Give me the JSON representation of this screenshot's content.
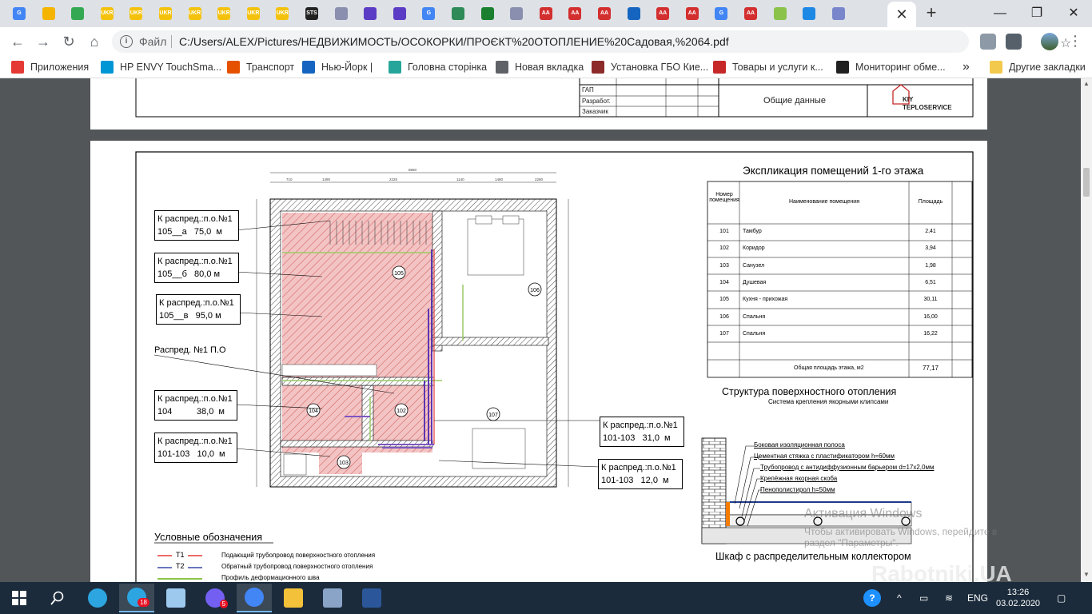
{
  "browser": {
    "tabs": [
      {
        "icon": "google-icon",
        "color": "#4285f4",
        "text": "G"
      },
      {
        "icon": "bookmark-tab-icon",
        "color": "#f4b400",
        "text": ""
      },
      {
        "icon": "mail-icon",
        "color": "#34a853",
        "text": ""
      },
      {
        "icon": "uka-go-icon",
        "color": "#f4c20d",
        "text": "UKR GO"
      },
      {
        "icon": "uka-go-icon",
        "color": "#f4c20d",
        "text": "UKR GO"
      },
      {
        "icon": "uka-go-icon",
        "color": "#f4c20d",
        "text": "UKR GO"
      },
      {
        "icon": "uka-go-icon",
        "color": "#f4c20d",
        "text": "UKR GO"
      },
      {
        "icon": "uka-go-icon",
        "color": "#f4c20d",
        "text": "UKR GO"
      },
      {
        "icon": "uka-go-icon",
        "color": "#f4c20d",
        "text": "UKR GO"
      },
      {
        "icon": "uka-go-icon",
        "color": "#f4c20d",
        "text": "UKR GO"
      },
      {
        "icon": "sts-icon",
        "color": "#222222",
        "text": "STS"
      },
      {
        "icon": "settings-tab-icon",
        "color": "#8a8fb0",
        "text": ""
      },
      {
        "icon": "purple-square-icon",
        "color": "#5b3cc4",
        "text": ""
      },
      {
        "icon": "purple-square-icon",
        "color": "#5b3cc4",
        "text": ""
      },
      {
        "icon": "google-icon",
        "color": "#4285f4",
        "text": "G"
      },
      {
        "icon": "lightning-icon",
        "color": "#2e8b57",
        "text": ""
      },
      {
        "icon": "green-circle-icon",
        "color": "#1a7f2e",
        "text": ""
      },
      {
        "icon": "settings-tab-icon",
        "color": "#8a8fb0",
        "text": ""
      },
      {
        "icon": "aa-icon",
        "color": "#d32f2f",
        "text": "AA"
      },
      {
        "icon": "aa-icon",
        "color": "#d32f2f",
        "text": "AA"
      },
      {
        "icon": "aa-icon",
        "color": "#d32f2f",
        "text": "AA"
      },
      {
        "icon": "chat-icon",
        "color": "#1565c0",
        "text": ""
      },
      {
        "icon": "aa-icon",
        "color": "#d32f2f",
        "text": "AA"
      },
      {
        "icon": "aa-icon",
        "color": "#d32f2f",
        "text": "AA"
      },
      {
        "icon": "google-icon",
        "color": "#4285f4",
        "text": "G"
      },
      {
        "icon": "aa-icon",
        "color": "#d32f2f",
        "text": "AA"
      },
      {
        "icon": "search-tab-icon",
        "color": "#8bc34a",
        "text": ""
      },
      {
        "icon": "house-icon",
        "color": "#1e88e5",
        "text": ""
      },
      {
        "icon": "snowflake-icon",
        "color": "#7986cb",
        "text": ""
      }
    ],
    "active_tab_close": "✕",
    "new_tab": "+",
    "window": {
      "minimize": "—",
      "restore": "❐",
      "close": "✕"
    },
    "omnibox": {
      "label": "Файл",
      "url": "C:/Users/ALEX/Pictures/НЕДВИЖИМОСТЬ/ОСОКОРКИ/ПРОЄКТ%20ОТОПЛЕНИЕ%20Садовая,%2064.pdf"
    },
    "bookmarks": [
      {
        "label": "Приложения",
        "icon": "apps-grid-icon",
        "color": "#e53935"
      },
      {
        "label": "HP ENVY TouchSma...",
        "icon": "hp-icon",
        "color": "#0096d6"
      },
      {
        "label": "Транспорт",
        "icon": "bars-icon",
        "color": "#e65100"
      },
      {
        "label": "Нью-Йорк |",
        "icon": "rusrek-icon",
        "color": "#1565c0"
      },
      {
        "label": "Головна сторінка",
        "icon": "tree-icon",
        "color": "#26a69a"
      },
      {
        "label": "Новая вкладка",
        "icon": "globe-icon",
        "color": "#5f6368"
      },
      {
        "label": "Установка ГБО Кие...",
        "icon": "gear-bookmark-icon",
        "color": "#8d2b2b"
      },
      {
        "label": "Товары и услуги к...",
        "icon": "bars-icon",
        "color": "#c62828"
      },
      {
        "label": "Мониторинг обме...",
        "icon": "bc-icon",
        "color": "#212121"
      }
    ],
    "bookmarks_more": "»",
    "other_bookmarks": "Другие закладки"
  },
  "pdf": {
    "page1": {
      "rows": [
        "ГАП",
        "Разработ.",
        "Заказчик"
      ],
      "title_cell": "Общие данные",
      "logo_line1": "KIY",
      "logo_line2": "TEPLOSERVICE"
    },
    "plan": {
      "callouts": [
        {
          "line1": "К распред.:п.о.№1",
          "line2": "105__а   75,0  м"
        },
        {
          "line1": "К распред.:п.о.№1",
          "line2": "105__б   80,0 м"
        },
        {
          "line1": "К распред.:п.о.№1",
          "line2": "105__в   95,0 м"
        },
        {
          "line1": "К распред.:п.о.№1",
          "line2": "104          38,0  м"
        },
        {
          "line1": "К распред.:п.о.№1",
          "line2": "101-103   10,0  м"
        },
        {
          "line1": "К распред.:п.о.№1",
          "line2": "101-103   31,0  м"
        },
        {
          "line1": "К распред.:п.о.№1",
          "line2": "101-103   12,0  м"
        }
      ],
      "distributor_label": "Распред. №1 П.О",
      "room_tags": [
        "105",
        "106",
        "104",
        "102",
        "107",
        "103"
      ],
      "dims_top": [
        "710",
        "1490",
        "2225",
        "1140",
        "1480",
        "2280"
      ],
      "dim_overall": "8660"
    },
    "explication": {
      "title": "Экспликация помещений 1-го этажа",
      "headers": [
        "Номер помещения",
        "Наименование помещения",
        "Площадь"
      ],
      "rows": [
        {
          "num": "101",
          "name": "Тамбур",
          "area": "2,41"
        },
        {
          "num": "102",
          "name": "Коридор",
          "area": "3,94"
        },
        {
          "num": "103",
          "name": "Санузел",
          "area": "1,98"
        },
        {
          "num": "104",
          "name": "Душевая",
          "area": "6,51"
        },
        {
          "num": "105",
          "name": "Кухня - прихожая",
          "area": "30,11"
        },
        {
          "num": "106",
          "name": "Спальня",
          "area": "16,00"
        },
        {
          "num": "107",
          "name": "Спальня",
          "area": "16,22"
        }
      ],
      "total_label": "Общая площадь этажа, м2",
      "total_value": "77,17"
    },
    "structure": {
      "title": "Структура поверхностного отопления",
      "subtitle": "Система крепления якорными клипсами",
      "layers": [
        "Боковая изоляционная полоса",
        "Цементная стяжка с пластификатором h=60мм",
        "Трубопровод с антидиффузионным барьером d=17x2,0мм",
        "Крепёжная якорная скоба",
        "Пенополистирол h=50мм"
      ],
      "cabinet_title": "Шкаф с распределительным коллектором"
    },
    "legend": {
      "title": "Условные обозначения",
      "items": [
        {
          "code": "T1",
          "text": "Подающий трубопровод поверхностного отопления",
          "color": "#e53935"
        },
        {
          "code": "T2",
          "text": "Обратный трубопровод поверхностного отопления",
          "color": "#3949ab"
        },
        {
          "code": "",
          "text": "Профиль деформационного шва",
          "color": "#8bc34a"
        }
      ]
    },
    "activation": {
      "line1": "Активация Windows",
      "line2": "Чтобы активировать Windows, перейдите в",
      "line3": "раздел \"Параметры\"."
    },
    "site_watermark": "Rabotniki.UA"
  },
  "taskbar": {
    "apps": [
      {
        "name": "telegram-icon",
        "color": "#2ca5e0",
        "badge": ""
      },
      {
        "name": "telegram-icon",
        "color": "#2ca5e0",
        "badge": "18",
        "active": true
      },
      {
        "name": "notepad-icon",
        "color": "#9ec9ef",
        "badge": ""
      },
      {
        "name": "viber-icon",
        "color": "#7360f2",
        "badge": "5"
      },
      {
        "name": "chrome-icon",
        "color": "#4285f4",
        "badge": "",
        "active": true
      },
      {
        "name": "folder-icon",
        "color": "#f3c13a",
        "badge": ""
      },
      {
        "name": "paint-icon",
        "color": "#89a4c7",
        "badge": ""
      },
      {
        "name": "word-icon",
        "color": "#2b579a",
        "badge": ""
      }
    ],
    "lang": "ENG",
    "time": "13:26",
    "date": "03.02.2020"
  }
}
